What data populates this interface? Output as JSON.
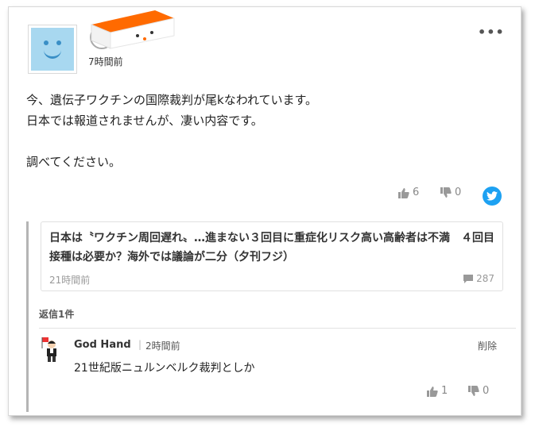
{
  "post": {
    "timestamp": "7時間前",
    "more_label": "•••",
    "body_lines": [
      "今、遺伝子ワクチンの国際裁判が尾kなわれています。",
      "日本では報道されませんが、凄い内容です。",
      "",
      "調べてください。"
    ],
    "likes": "6",
    "dislikes": "0"
  },
  "article": {
    "title": "日本は〝ワクチン周回遅れ〟…進まない３回目に重症化リスク高い高齢者は不満　４回目接種は必要か？海外では議論が二分（夕刊フジ）",
    "time": "21時間前",
    "comment_count": "287"
  },
  "replies": {
    "label": "返信1件",
    "items": [
      {
        "name": "God Hand",
        "separator": "|",
        "time": "2時間前",
        "delete_label": "削除",
        "text": "21世紀版ニュルンベルク裁判としか",
        "likes": "1",
        "dislikes": "0"
      }
    ]
  },
  "icons": {
    "avatar": "smiley-avatar",
    "like": "thumbs-up-icon",
    "dislike": "thumbs-down-icon",
    "twitter": "twitter-icon",
    "comment": "comment-icon",
    "more": "more-icon"
  },
  "colors": {
    "avatar_bg": "#a8d8f0",
    "avatar_face": "#3a8fc6",
    "badge_orange": "#ff6a00",
    "twitter_blue": "#1da1f2",
    "thread_line": "#b5b5b5",
    "meta_gray": "#999999"
  }
}
